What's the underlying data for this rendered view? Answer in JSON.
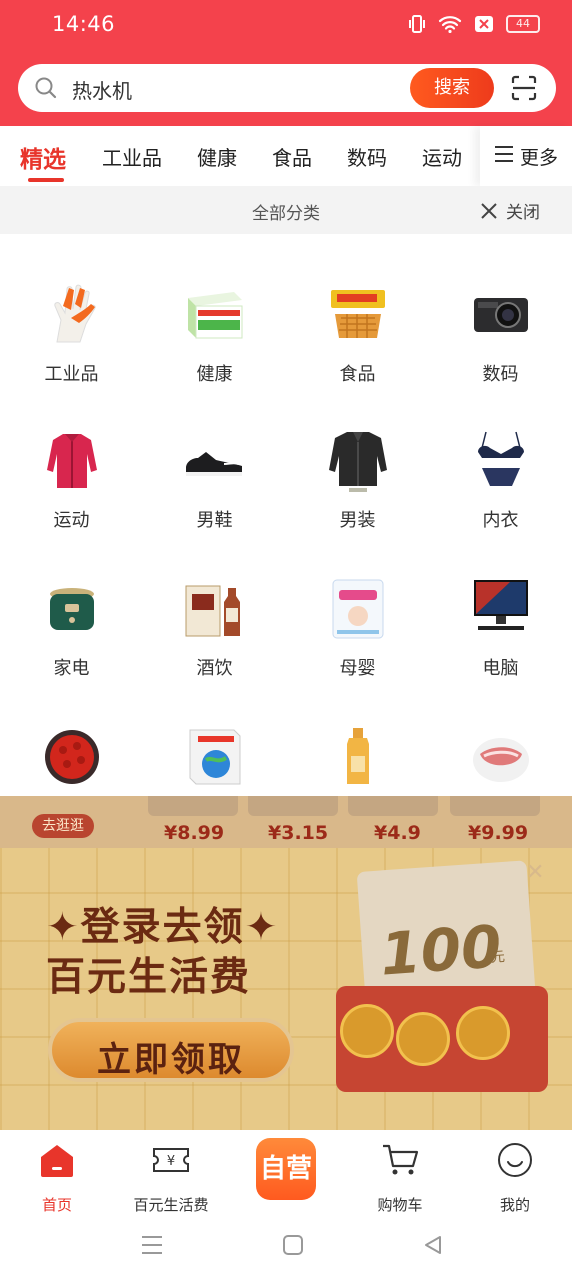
{
  "status_bar": {
    "time": "14:46",
    "battery": "44"
  },
  "search": {
    "query": "热水机",
    "button_label": "搜索"
  },
  "tabs": [
    {
      "label": "精选",
      "active": true
    },
    {
      "label": "工业品"
    },
    {
      "label": "健康"
    },
    {
      "label": "食品"
    },
    {
      "label": "数码"
    },
    {
      "label": "运动"
    }
  ],
  "more_label": "更多",
  "category_panel": {
    "title": "全部分类",
    "close_label": "关闭"
  },
  "categories": [
    {
      "label": "工业品",
      "icon": "glove-icon"
    },
    {
      "label": "健康",
      "icon": "medicine-box-icon"
    },
    {
      "label": "食品",
      "icon": "waffle-icon"
    },
    {
      "label": "数码",
      "icon": "camera-icon"
    },
    {
      "label": "运动",
      "icon": "jacket-icon"
    },
    {
      "label": "男鞋",
      "icon": "sneaker-icon"
    },
    {
      "label": "男装",
      "icon": "leather-jacket-icon"
    },
    {
      "label": "内衣",
      "icon": "lingerie-icon"
    },
    {
      "label": "家电",
      "icon": "rice-cooker-icon"
    },
    {
      "label": "酒饮",
      "icon": "liquor-icon"
    },
    {
      "label": "母婴",
      "icon": "diaper-icon"
    },
    {
      "label": "电脑",
      "icon": "computer-icon"
    },
    {
      "label": "",
      "icon": "roses-icon"
    },
    {
      "label": "",
      "icon": "book-icon"
    },
    {
      "label": "",
      "icon": "shampoo-icon"
    },
    {
      "label": "",
      "icon": "meat-icon"
    }
  ],
  "promo_strip": {
    "store_button": "去逛逛",
    "prices": [
      "¥8.99",
      "¥3.15",
      "¥4.9",
      "¥9.99"
    ]
  },
  "promo": {
    "line1": "✦登录去领✦",
    "line2": "百元生活费",
    "button_label": "立即领取",
    "amount": "100",
    "unit": "元"
  },
  "bottom_nav": [
    {
      "label": "首页",
      "icon": "home-icon",
      "active": true
    },
    {
      "label": "百元生活费",
      "icon": "ticket-icon"
    },
    {
      "label": "",
      "icon": "self-operated-logo",
      "logo_text": "自营"
    },
    {
      "label": "购物车",
      "icon": "cart-icon"
    },
    {
      "label": "我的",
      "icon": "profile-icon"
    }
  ],
  "colors": {
    "brand_red": "#f4424c",
    "active_red": "#e8352b",
    "search_orange": "#ff5a1f"
  }
}
